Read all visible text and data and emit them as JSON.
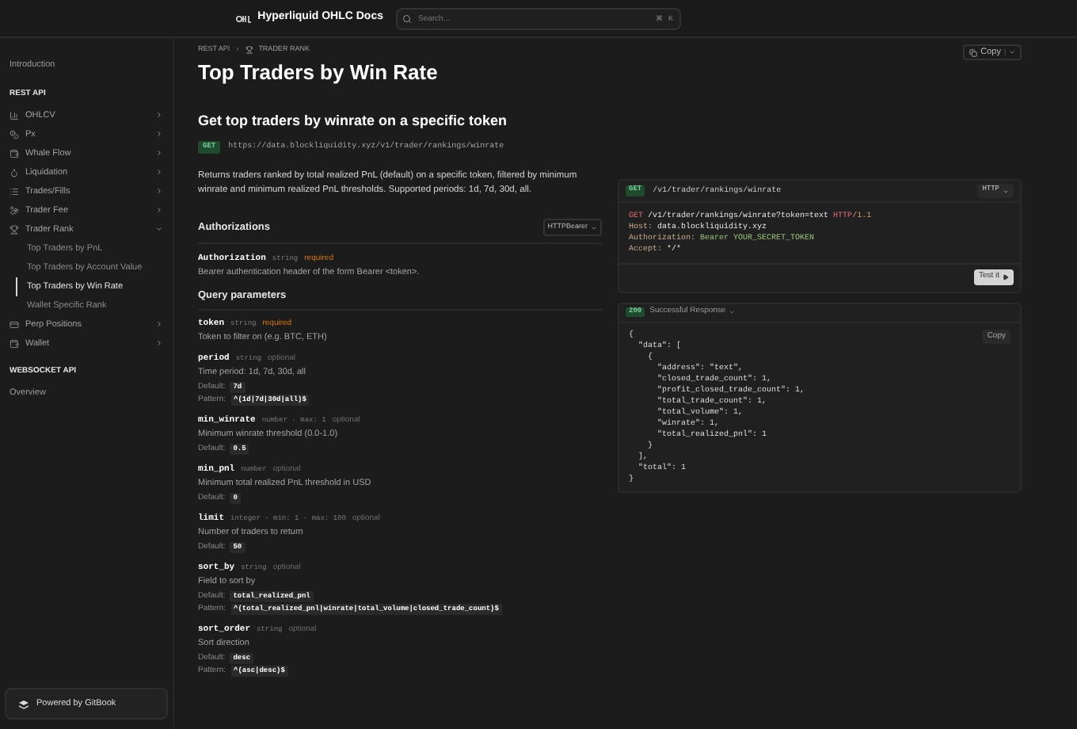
{
  "header": {
    "title": "Hyperliquid OHLC Docs",
    "search": {
      "placeholder": "Search..."
    },
    "shortcut": [
      "⌘",
      "K"
    ]
  },
  "sidebar": {
    "items": [
      {
        "kind": "link",
        "label": "Introduction",
        "selected": false
      },
      {
        "kind": "heading",
        "label": "REST API"
      },
      {
        "kind": "group",
        "label": "OHLCV",
        "expanded": false
      },
      {
        "kind": "group",
        "label": "Px",
        "expanded": false
      },
      {
        "kind": "group",
        "label": "Whale Flow",
        "expanded": false
      },
      {
        "kind": "group",
        "label": "Liquidation",
        "expanded": false
      },
      {
        "kind": "group",
        "label": "Trades/Fills",
        "expanded": false
      },
      {
        "kind": "group",
        "label": "Trader Fee",
        "expanded": false
      },
      {
        "kind": "group",
        "label": "Trader Rank",
        "expanded": true,
        "children": [
          {
            "label": "Top Traders by PnL",
            "selected": false
          },
          {
            "label": "Top Traders by Account Value",
            "selected": false
          },
          {
            "label": "Top Traders by Win Rate",
            "selected": true
          },
          {
            "label": "Wallet Specific Rank",
            "selected": false
          }
        ]
      },
      {
        "kind": "group",
        "label": "Perp Positions",
        "expanded": false
      },
      {
        "kind": "group",
        "label": "Wallet",
        "expanded": false
      },
      {
        "kind": "heading",
        "label": "WEBSOCKET API"
      },
      {
        "kind": "link",
        "label": "Overview",
        "selected": false
      }
    ],
    "footer": "Powered by GitBook"
  },
  "breadcrumb": [
    "REST API",
    "TRADER RANK"
  ],
  "page": {
    "title": "Top Traders by Win Rate",
    "copy": "Copy"
  },
  "endpoint": {
    "heading": "Get top traders by winrate on a specific token",
    "method": "GET",
    "url": "https://data.blockliquidity.xyz/v1/trader/rankings/winrate",
    "description": "Returns traders ranked by total realized PnL (default) on a specific token, filtered by minimum winrate and minimum realized PnL thresholds. Supported periods: 1d, 7d, 30d, all."
  },
  "authorizations": {
    "title": "Authorizations",
    "scheme": "HTTPBearer",
    "params": [
      {
        "name": "Authorization",
        "type": "string",
        "tag": "required",
        "required": true,
        "description": "Bearer authentication header of the form Bearer <token>."
      }
    ]
  },
  "query": {
    "title": "Query parameters",
    "params": [
      {
        "name": "token",
        "type": "string",
        "tag": "required",
        "required": true,
        "description": "Token to filter on (e.g. BTC, ETH)"
      },
      {
        "name": "period",
        "type": "string",
        "tag": "optional",
        "required": false,
        "description": "Time period: 1d, 7d, 30d, all",
        "default_label": "Default:",
        "default": "7d",
        "pattern_label": "Pattern:",
        "pattern": "^(1d|7d|30d|all)$"
      },
      {
        "name": "min_winrate",
        "type": "number · max: 1",
        "tag": "optional",
        "required": false,
        "description": "Minimum winrate threshold (0.0-1.0)",
        "default_label": "Default:",
        "default": "0.5"
      },
      {
        "name": "min_pnl",
        "type": "number",
        "tag": "optional",
        "required": false,
        "description": "Minimum total realized PnL threshold in USD",
        "default_label": "Default:",
        "default": "0"
      },
      {
        "name": "limit",
        "type": "integer · min: 1 · max: 100",
        "tag": "optional",
        "required": false,
        "description": "Number of traders to return",
        "default_label": "Default:",
        "default": "50"
      },
      {
        "name": "sort_by",
        "type": "string",
        "tag": "optional",
        "required": false,
        "description": "Field to sort by",
        "default_label": "Default:",
        "default": "total_realized_pnl",
        "pattern_label": "Pattern:",
        "pattern": "^(total_realized_pnl|winrate|total_volume|closed_trade_count)$"
      },
      {
        "name": "sort_order",
        "type": "string",
        "tag": "optional",
        "required": false,
        "description": "Sort direction",
        "default_label": "Default:",
        "default": "desc",
        "pattern_label": "Pattern:",
        "pattern": "^(asc|desc)$"
      }
    ]
  },
  "request": {
    "method": "GET",
    "path": "/v1/trader/rankings/winrate",
    "format": "HTTP",
    "lines": [
      [
        {
          "kind": "keyword",
          "text": "GET "
        },
        {
          "kind": "plain",
          "text": "/v1/trader/rankings/winrate?token=text "
        },
        {
          "kind": "keyword",
          "text": "HTTP"
        },
        {
          "kind": "dim",
          "text": "/1.1"
        }
      ],
      [
        {
          "kind": "key",
          "text": "Host: "
        },
        {
          "kind": "plain",
          "text": "data.blockliquidity.xyz"
        }
      ],
      [
        {
          "kind": "key",
          "text": "Authorization: "
        },
        {
          "kind": "value",
          "text": "Bearer YOUR_SECRET_TOKEN"
        }
      ],
      [
        {
          "kind": "key",
          "text": "Accept: "
        },
        {
          "kind": "plain",
          "text": "*/*"
        }
      ]
    ],
    "test": "Test it"
  },
  "response": {
    "status": "200",
    "label": "Successful Response",
    "copy": "Copy",
    "lines": [
      "{",
      "  \"data\": [",
      "    {",
      "      \"address\": \"text\",",
      "      \"closed_trade_count\": 1,",
      "      \"profit_closed_trade_count\": 1,",
      "      \"total_trade_count\": 1,",
      "      \"total_volume\": 1,",
      "      \"winrate\": 1,",
      "      \"total_realized_pnl\": 1",
      "    }",
      "  ],",
      "  \"total\": 1",
      "}"
    ]
  }
}
